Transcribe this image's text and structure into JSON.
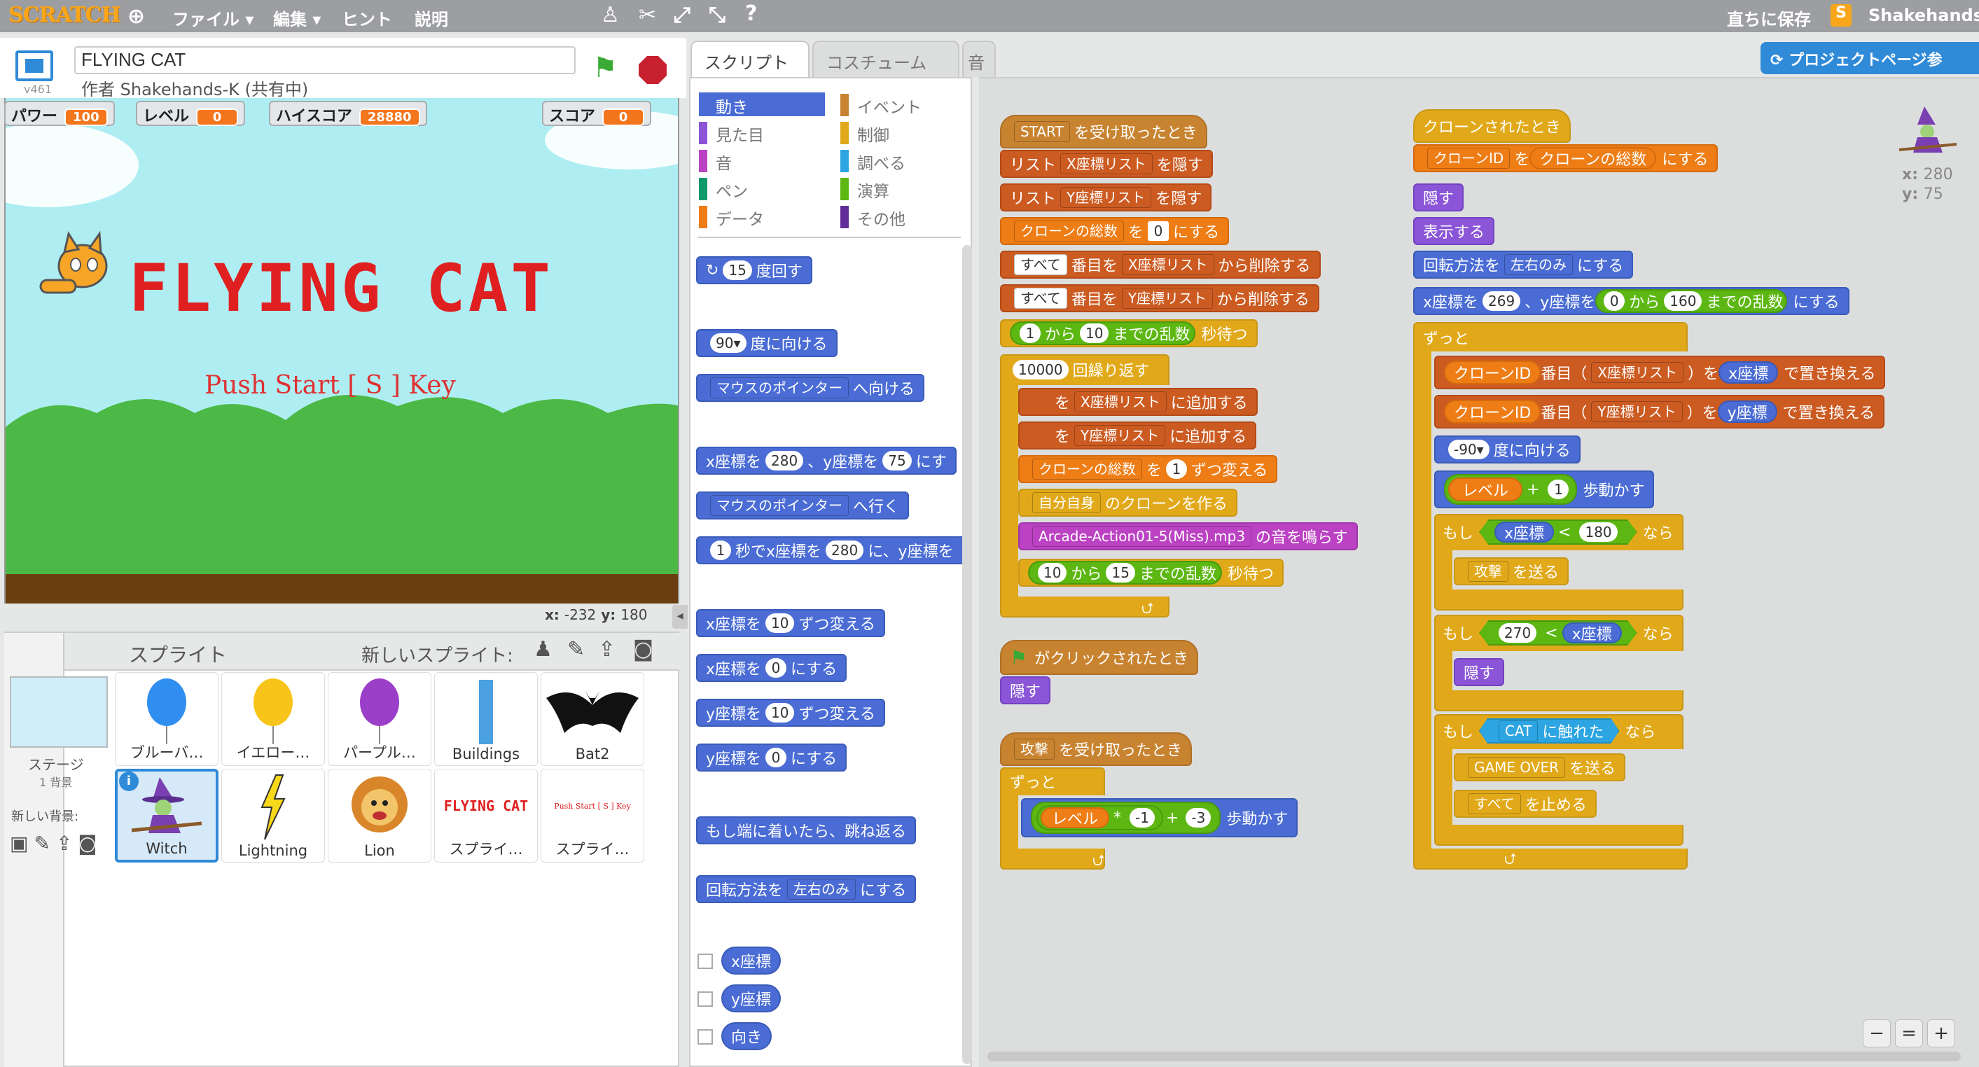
{
  "menubar": {
    "logo": "SCRATCH",
    "file": "ファイル ▾",
    "edit": "編集 ▾",
    "hint": "ヒント",
    "about": "説明",
    "save_now": "直ちに保存",
    "username": "Shakehands-K"
  },
  "project": {
    "title": "FLYING CAT",
    "author": "作者 Shakehands-K (共有中)",
    "version": "v461"
  },
  "monitors": {
    "power": {
      "label": "パワー",
      "value": "100"
    },
    "level": {
      "label": "レベル",
      "value": "0"
    },
    "highscore": {
      "label": "ハイスコア",
      "value": "28880"
    },
    "score": {
      "label": "スコア",
      "value": "0"
    }
  },
  "stage": {
    "title_text": "FLYING CAT",
    "push_text": "Push Start [ S ] Key",
    "coords_x_label": "x:",
    "coords_x": "-232",
    "coords_y_label": "y:",
    "coords_y": "180"
  },
  "sprites_panel": {
    "header": "スプライト",
    "new_sprite": "新しいスプライト:",
    "stage_label": "ステージ",
    "stage_backdrops": "1 背景",
    "new_backdrop": "新しい背景:",
    "sprites": [
      "ブルーバ…",
      "イエロー…",
      "パープル…",
      "Buildings",
      "Bat2",
      "Witch",
      "Lightning",
      "Lion",
      "スプライ…",
      "スプライ…"
    ],
    "thumb_flying_cat": "FLYING CAT",
    "thumb_push": "Push Start [ S ] Key",
    "info_badge": "i"
  },
  "tabs": {
    "scripts": "スクリプト",
    "costumes": "コスチューム",
    "sounds": "音"
  },
  "categories": [
    "動き",
    "イベント",
    "見た目",
    "制御",
    "音",
    "調べる",
    "ペン",
    "演算",
    "データ",
    "その他"
  ],
  "category_colors": [
    "#4a6cd4",
    "#c88330",
    "#8a55d7",
    "#e1a91a",
    "#bb42c3",
    "#2ca5e2",
    "#0e9a6c",
    "#5cb712",
    "#ee7d16",
    "#632d99"
  ],
  "palette": {
    "turn_val": "15",
    "turn_label": "度回す",
    "point_dir_val": "90▾",
    "point_dir_label": "度に向ける",
    "mouse_pointer": "マウスのポインター",
    "point_towards": "へ向ける",
    "goto_x_label": "x座標を",
    "goto_x": "280",
    "goto_sep": "、y座標を",
    "goto_y": "75",
    "goto_end": "にす",
    "goto_target": "へ行く",
    "glide_secs": "1",
    "glide_label": "秒でx座標を",
    "glide_x": "280",
    "glide_sep": "に、y座標を",
    "change_x_label": "x座標を",
    "change_x": "10",
    "change_end": "ずつ変える",
    "set_x_label": "x座標を",
    "set_x": "0",
    "set_end": "にする",
    "change_y_label": "y座標を",
    "change_y": "10",
    "set_y_label": "y座標を",
    "set_y": "0",
    "bounce": "もし端に着いたら、跳ね返る",
    "rotation_label": "回転方法を",
    "rotation_val": "左右のみ",
    "rotation_end": "にする",
    "rep_x": "x座標",
    "rep_y": "y座標",
    "rep_dir": "向き"
  },
  "scripts": {
    "s1_msg": "START",
    "s1_hat": "を受け取ったとき",
    "list_label": "リスト",
    "xlist": "X座標リスト",
    "ylist": "Y座標リスト",
    "hide_list": "を隠す",
    "clone_total": "クローンの総数",
    "to": "を",
    "zero": "0",
    "set_to": "にする",
    "all": "すべて",
    "item_th": "番目を",
    "delete_from": "から削除する",
    "rand_from": "1",
    "kara": "から",
    "rand_to": "10",
    "rand_end": "までの乱数",
    "wait_secs": "秒待つ",
    "repeat_n": "10000",
    "repeat_label": "回繰り返す",
    "add_to": "に追加する",
    "by_one": "1",
    "change_by": "ずつ変える",
    "myself": "自分自身",
    "create_clone_of": "のクローンを作る",
    "sound_name": "Arcade-Action01-5(Miss).mp3",
    "play_sound": "の音を鳴らす",
    "rand2_from": "10",
    "rand2_to": "15",
    "flag_hat": "がクリックされたとき",
    "hide": "隠す",
    "attack_msg": "攻撃",
    "forever": "ずっと",
    "level_var": "レベル",
    "times": "*",
    "minus_one": "-1",
    "plus": "+",
    "minus_three": "-3",
    "move_steps": "歩動かす",
    "clone_hat": "クローンされたとき",
    "clone_id": "クローンID",
    "show": "表示する",
    "rot_label": "回転方法を",
    "rot_val": "左右のみ",
    "setxy_x_label": "x座標を",
    "setxy_x": "269",
    "setxy_sep": "、y座標を",
    "setxy_rand_from": "0",
    "setxy_rand_to": "160",
    "setxy_end": "にする",
    "item_label": "番目（",
    "paren_close": "）",
    "replace_with": "で置き換える",
    "xpos": "x座標",
    "ypos": "y座標",
    "point_minus90": "-90▾",
    "point_label": "度に向ける",
    "plus1": "1",
    "if_label": "もし",
    "then_label": "なら",
    "lt": "<",
    "n180": "180",
    "n270": "270",
    "broadcast": "を送る",
    "touching_obj": "CAT",
    "touching": "に触れた",
    "game_over": "GAME OVER",
    "stop_all": "すべて",
    "stop_label": "を止める"
  },
  "right": {
    "project_page": "プロジェクトページ参",
    "sprite_x_label": "x:",
    "sprite_x": "280",
    "sprite_y_label": "y:",
    "sprite_y": "75"
  }
}
